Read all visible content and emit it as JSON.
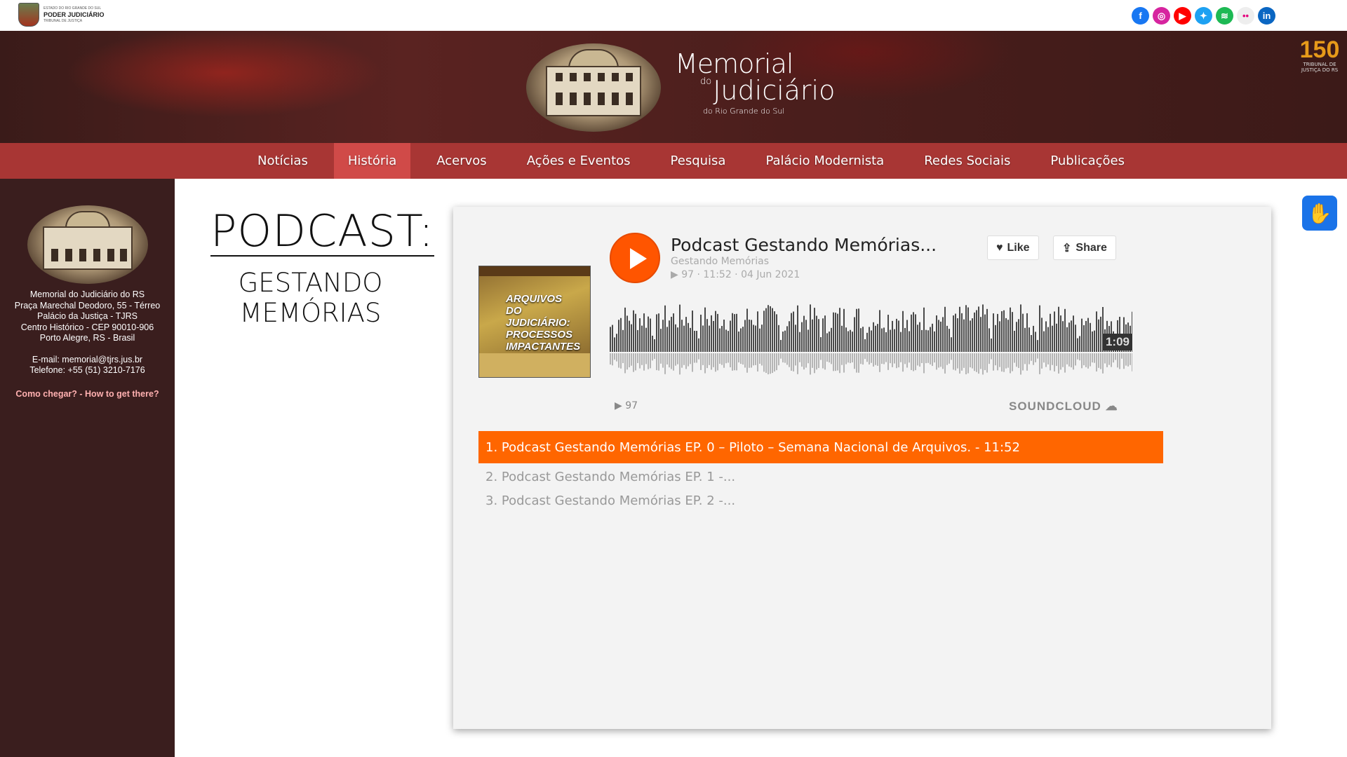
{
  "topbar": {
    "org_small": "ESTADO DO RIO GRANDE DO SUL",
    "org_main": "PODER JUDICIÁRIO",
    "org_sub": "TRIBUNAL DE JUSTIÇA",
    "social": [
      {
        "name": "facebook",
        "glyph": "f",
        "color": "#1877f2"
      },
      {
        "name": "instagram",
        "glyph": "◎",
        "color": "#d6249f"
      },
      {
        "name": "youtube",
        "glyph": "▶",
        "color": "#ff0000"
      },
      {
        "name": "twitter",
        "glyph": "✦",
        "color": "#1da1f2"
      },
      {
        "name": "spotify",
        "glyph": "≋",
        "color": "#1db954"
      },
      {
        "name": "flickr",
        "glyph": "••",
        "color": "#eee"
      },
      {
        "name": "linkedin",
        "glyph": "in",
        "color": "#0a66c2"
      }
    ]
  },
  "banner": {
    "title_line1": "Memorial",
    "title_do": "do",
    "title_line2": "Judiciário",
    "title_line3": "do Rio Grande do Sul",
    "badge_number": "150",
    "badge_line1": "TRIBUNAL DE",
    "badge_line2": "JUSTIÇA DO RS"
  },
  "nav": {
    "items": [
      {
        "label": "Notícias"
      },
      {
        "label": "História"
      },
      {
        "label": "Acervos"
      },
      {
        "label": "Ações e Eventos"
      },
      {
        "label": "Pesquisa"
      },
      {
        "label": "Palácio Modernista"
      },
      {
        "label": "Redes Sociais"
      },
      {
        "label": "Publicações"
      }
    ],
    "active": "História"
  },
  "sidebar": {
    "line1": "Memorial do Judiciário do RS",
    "line2": "Praça Marechal Deodoro, 55 - Térreo",
    "line3": "Palácio da Justiça - TJRS",
    "line4": "Centro Histórico - CEP 90010-906",
    "line5": "Porto Alegre, RS - Brasil",
    "email": "E-mail: memorial@tjrs.jus.br",
    "phone": "Telefone: +55 (51) 3210-7176",
    "link": "Como chegar? - How to get there?"
  },
  "heading": {
    "title": "PODCAST:",
    "sub1": "GESTANDO",
    "sub2": "MEMÓRIAS"
  },
  "player": {
    "track_title": "Podcast Gestando Memórias...",
    "artist": "Gestando Memórias",
    "meta": "97 · 11:52 · 04 Jun 2021",
    "like": "Like",
    "share": "Share",
    "time": "1:09",
    "plays": "97",
    "brand": "SOUNDCLOUD",
    "cover_title": "ARQUIVOS DO JUDICIÁRIO: PROCESSOS IMPACTANTES",
    "tracks": [
      "1. Podcast Gestando Memórias EP. 0 – Piloto – Semana Nacional de Arquivos. - 11:52",
      "2. Podcast Gestando Memórias EP. 1 -...",
      "3. Podcast Gestando Memórias EP. 2 -..."
    ]
  },
  "colors": {
    "nav_bg": "#a83634",
    "nav_active": "#d04a48",
    "sidebar_bg": "#3a1e1e",
    "soundcloud": "#ff5500",
    "track_active": "#ff6600"
  }
}
